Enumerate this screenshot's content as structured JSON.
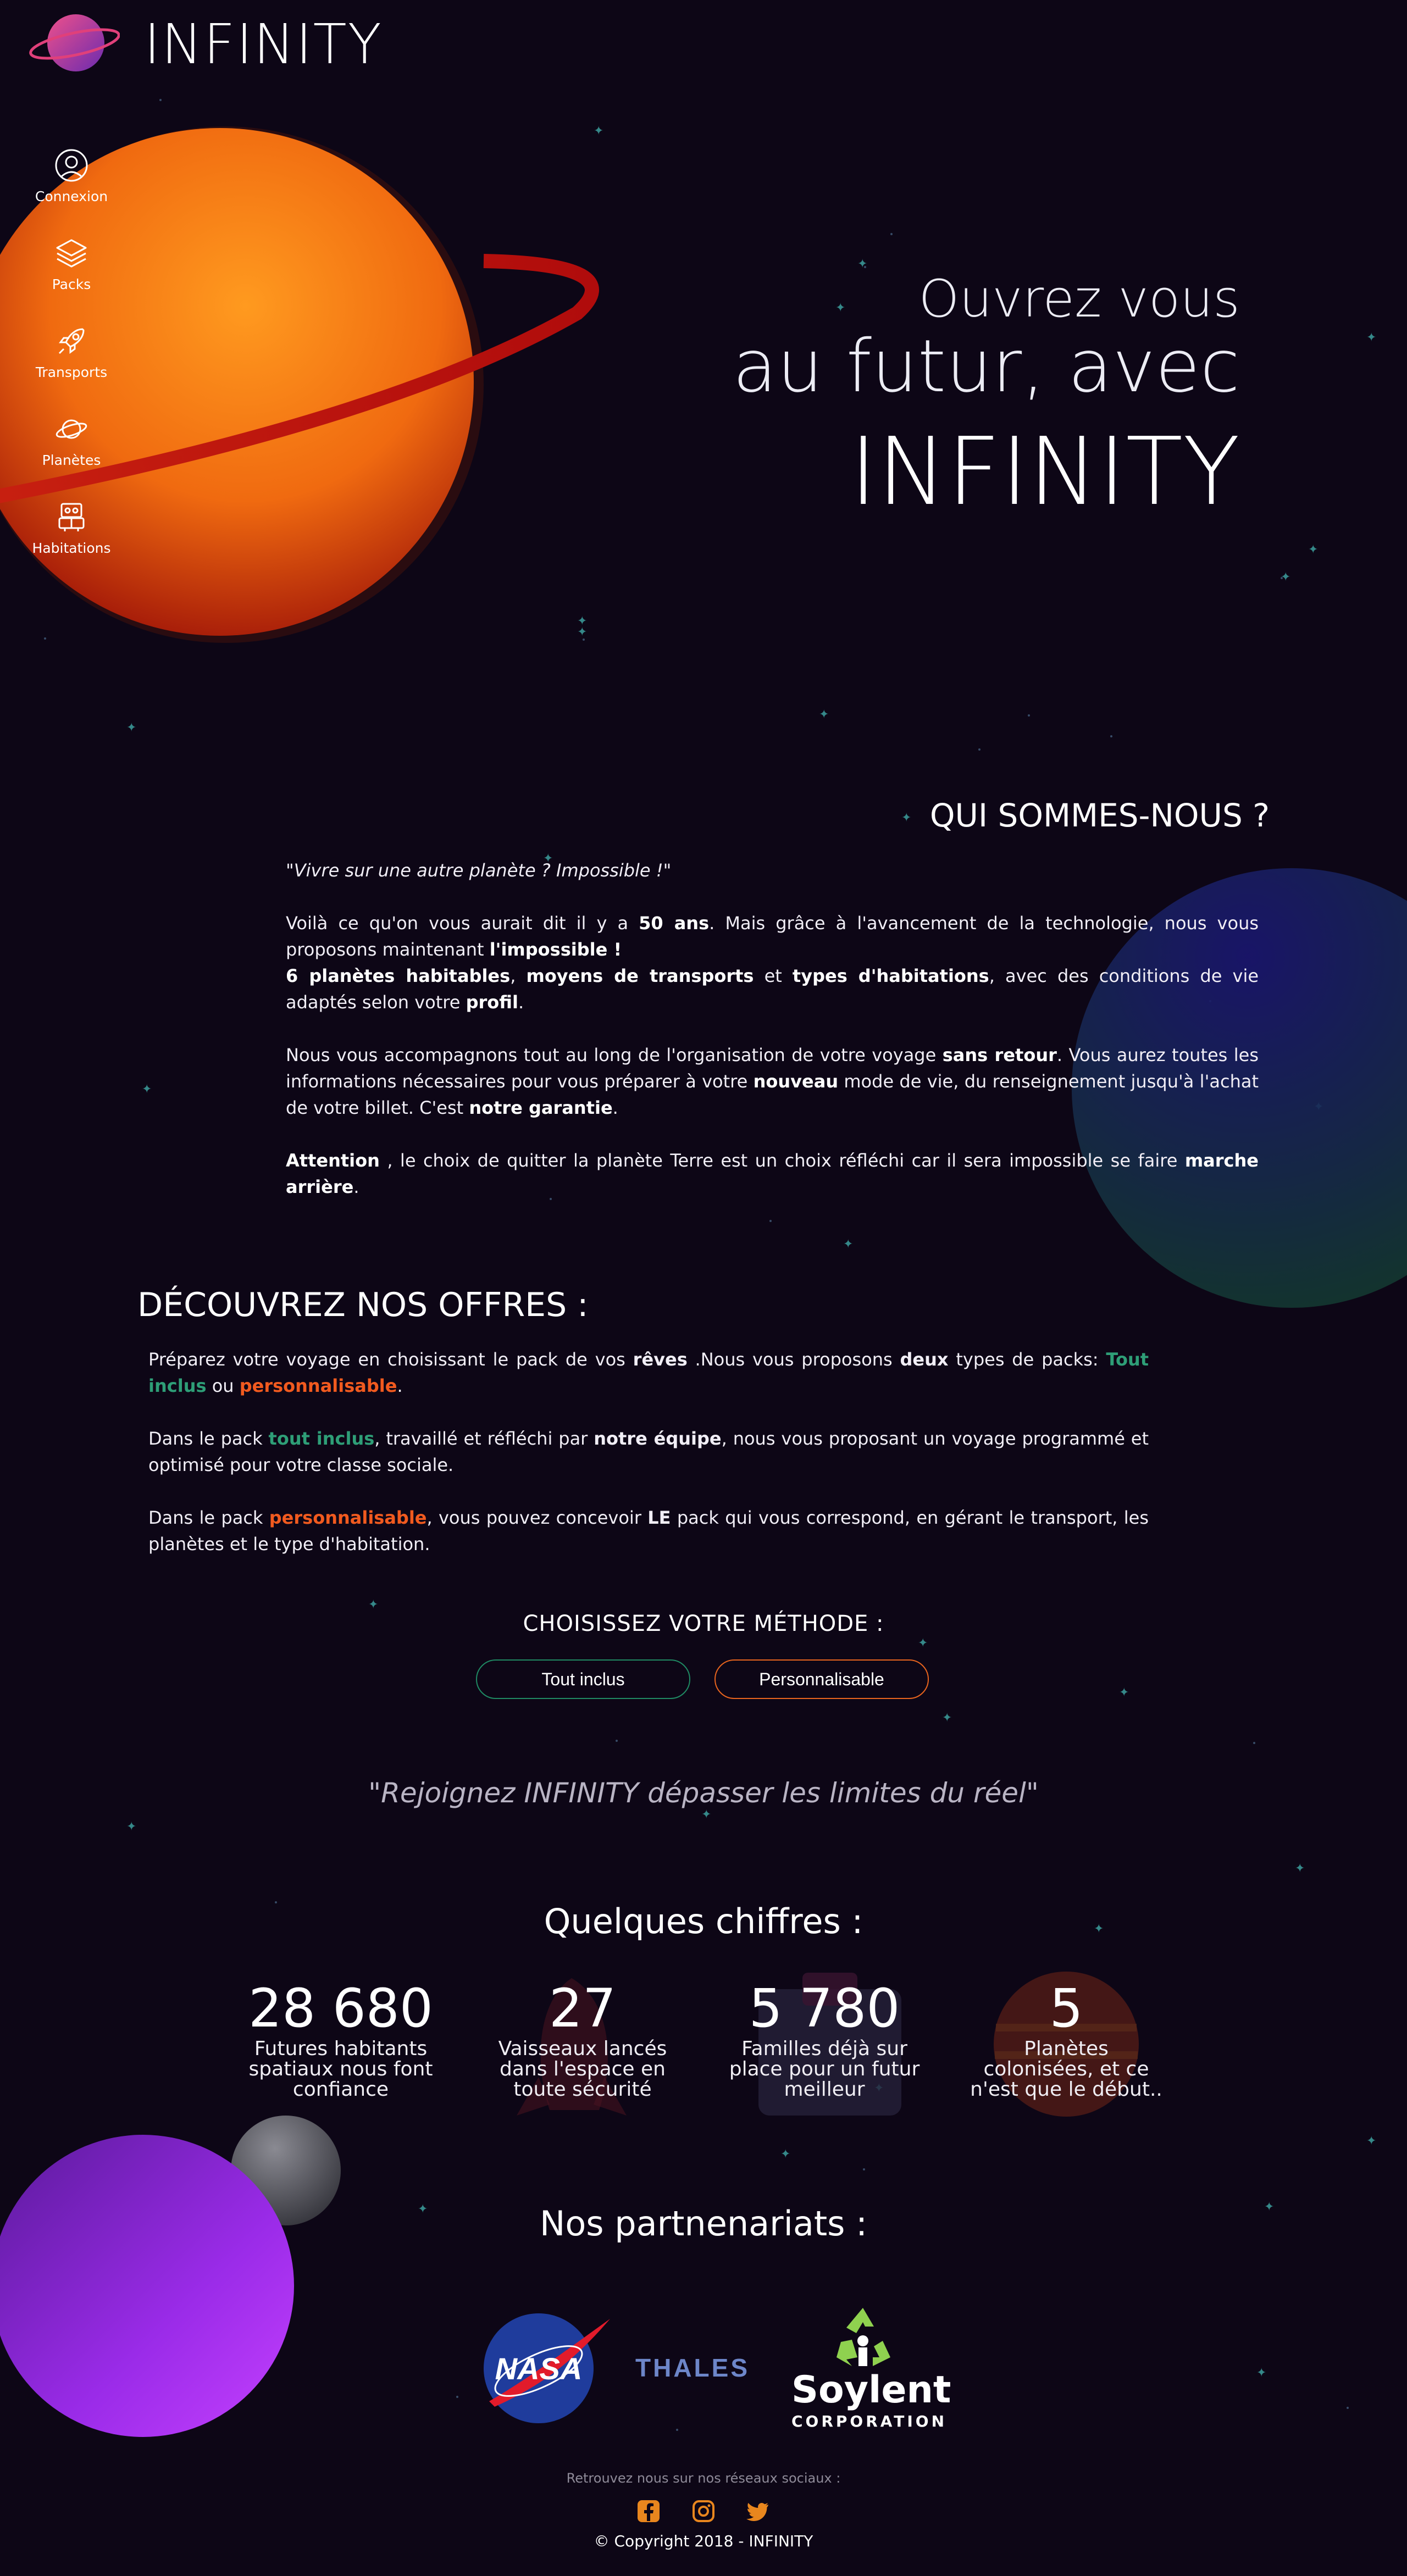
{
  "brand": {
    "name": "INFINITY"
  },
  "sidebar": {
    "items": [
      {
        "label": "Connexion",
        "icon": "user-icon"
      },
      {
        "label": "Packs",
        "icon": "layers-icon"
      },
      {
        "label": "Transports",
        "icon": "rocket-icon"
      },
      {
        "label": "Planètes",
        "icon": "planet-icon"
      },
      {
        "label": "Habitations",
        "icon": "robot-icon"
      }
    ]
  },
  "hero": {
    "line1": "Ouvrez vous",
    "line2": "au futur, avec",
    "line3": "INFINITY"
  },
  "about": {
    "title": "QUI SOMMES-NOUS ?",
    "quote": "\"Vivre sur une autre planète ? Impossible !\"",
    "p1": {
      "a": "Voilà ce qu'on vous aurait dit il y a ",
      "b": "50 ans",
      "c": ". Mais grâce à l'avancement de la technologie, nous vous proposons maintenant ",
      "d": "l'impossible !"
    },
    "p2": {
      "a": "6 planètes habitables",
      "b": ", ",
      "c": "moyens de transports",
      "d": " et ",
      "e": "types d'habitations",
      "f": ", avec des conditions de vie adaptés selon votre ",
      "g": "profil",
      "h": "."
    },
    "p3": {
      "a": "Nous vous accompagnons tout au long de l'organisation de votre voyage ",
      "b": "sans retour",
      "c": ". Vous aurez toutes les informations nécessaires pour vous préparer à votre ",
      "d": "nouveau",
      "e": " mode de vie, du renseignement jusqu'à l'achat de votre billet. C'est ",
      "f": "notre garantie",
      "g": "."
    },
    "p4": {
      "a": "Attention",
      "b": " , le choix de quitter la planète Terre est un choix réfléchi car il sera impossible se faire ",
      "c": "marche arrière",
      "d": "."
    }
  },
  "offers": {
    "title": "DÉCOUVREZ NOS OFFRES :",
    "p1": {
      "a": "Préparez votre voyage en choisissant le pack de vos ",
      "b": "rêves",
      "c": " .Nous vous proposons ",
      "d": "deux",
      "e": " types de packs: ",
      "f": "Tout inclus",
      "g": " ou ",
      "h": "personnalisable",
      "i": "."
    },
    "p2": {
      "a": "Dans le pack ",
      "b": "tout inclus",
      "c": ", travaillé et réfléchi par ",
      "d": "notre équipe",
      "e": ", nous vous proposant un voyage programmé et optimisé pour votre classe sociale."
    },
    "p3": {
      "a": "Dans le pack ",
      "b": "personnalisable",
      "c": ", vous pouvez concevoir ",
      "d": "LE",
      "e": " pack qui vous correspond, en gérant le transport, les planètes et le type d'habitation."
    },
    "method_title": "CHOISISSEZ VOTRE MÉTHODE :",
    "btn_all": "Tout inclus",
    "btn_custom": "Personnalisable"
  },
  "slogan": "\"Rejoignez INFINITY dépasser les limites du réel\"",
  "stats": {
    "title": "Quelques chiffres :",
    "items": [
      {
        "value": "28 680",
        "label": "Futures habitants spatiaux nous font confiance"
      },
      {
        "value": "27",
        "label": "Vaisseaux lancés dans l'espace en toute sécurité"
      },
      {
        "value": "5 780",
        "label": "Familles déjà sur place pour un futur meilleur"
      },
      {
        "value": "5",
        "label": "Planètes colonisées, et ce n'est que le début.."
      }
    ]
  },
  "partners": {
    "title": "Nos partnenariats :",
    "logos": [
      {
        "name": "NASA",
        "icon": "nasa-logo"
      },
      {
        "name": "THALES",
        "icon": "thales-logo"
      },
      {
        "name": "Soylent",
        "sub": "CORPORATION",
        "icon": "soylent-logo"
      }
    ]
  },
  "footer": {
    "social_text": "Retrouvez nous sur nos réseaux sociaux :",
    "social": [
      "facebook-icon",
      "instagram-icon",
      "twitter-icon"
    ],
    "copyright": "© Copyright 2018 - INFINITY"
  },
  "colors": {
    "background": "#0d0616",
    "green": "#2e9e77",
    "orange": "#f15a1f",
    "social": "#e8861e"
  }
}
